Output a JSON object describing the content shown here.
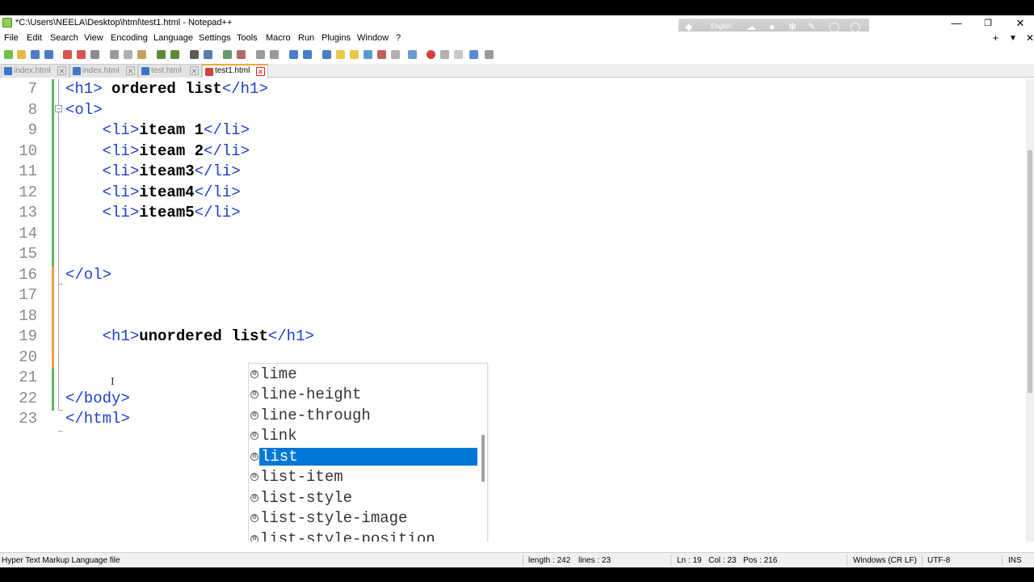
{
  "window": {
    "title": "*C:\\Users\\NEELA\\Desktop\\html\\test1.html - Notepad++",
    "min_glyph": "—",
    "max_glyph": "❐",
    "close_glyph": "✕"
  },
  "langbar": {
    "label": "English"
  },
  "menu": {
    "items": [
      "File",
      "Edit",
      "Search",
      "View",
      "Encoding",
      "Language",
      "Settings",
      "Tools",
      "Macro",
      "Run",
      "Plugins",
      "Window",
      "?"
    ],
    "right": [
      "+",
      "▼",
      "✕"
    ]
  },
  "tabs": [
    {
      "label": "index.html",
      "active": false
    },
    {
      "label": "index.html",
      "active": false
    },
    {
      "label": "test.html",
      "active": false
    },
    {
      "label": "test1.html",
      "active": true
    }
  ],
  "editor": {
    "lines": [
      {
        "n": "7",
        "code": [
          [
            "tag",
            "<h1>"
          ],
          [
            "txt",
            " ordered list"
          ],
          [
            "tag",
            "</h1>"
          ]
        ]
      },
      {
        "n": "8",
        "code": [
          [
            "tag",
            "<ol>"
          ]
        ]
      },
      {
        "n": "9",
        "code": [
          [
            "tag",
            "    <li>"
          ],
          [
            "txt",
            "iteam 1"
          ],
          [
            "tag",
            "</li>"
          ]
        ]
      },
      {
        "n": "10",
        "code": [
          [
            "tag",
            "    <li>"
          ],
          [
            "txt",
            "iteam 2"
          ],
          [
            "tag",
            "</li>"
          ]
        ]
      },
      {
        "n": "11",
        "code": [
          [
            "tag",
            "    <li>"
          ],
          [
            "txt",
            "iteam3"
          ],
          [
            "tag",
            "</li>"
          ]
        ]
      },
      {
        "n": "12",
        "code": [
          [
            "tag",
            "    <li>"
          ],
          [
            "txt",
            "iteam4"
          ],
          [
            "tag",
            "</li>"
          ]
        ]
      },
      {
        "n": "13",
        "code": [
          [
            "tag",
            "    <li>"
          ],
          [
            "txt",
            "iteam5"
          ],
          [
            "tag",
            "</li>"
          ]
        ]
      },
      {
        "n": "14",
        "code": []
      },
      {
        "n": "15",
        "code": []
      },
      {
        "n": "16",
        "code": [
          [
            "tag",
            "</ol>"
          ]
        ]
      },
      {
        "n": "17",
        "code": []
      },
      {
        "n": "18",
        "code": []
      },
      {
        "n": "19",
        "code": [
          [
            "tag",
            "    <h1>"
          ],
          [
            "txt",
            "unordered list"
          ],
          [
            "tag",
            "</h1>"
          ]
        ]
      },
      {
        "n": "20",
        "code": []
      },
      {
        "n": "21",
        "code": []
      },
      {
        "n": "22",
        "code": [
          [
            "tag",
            "</body>"
          ]
        ]
      },
      {
        "n": "23",
        "code": [
          [
            "tag",
            "</html>"
          ]
        ]
      }
    ]
  },
  "autocomplete": {
    "items": [
      "lime",
      "line-height",
      "line-through",
      "link",
      "list",
      "list-item",
      "list-style",
      "list-style-image",
      "list-style-position"
    ],
    "selected": "list"
  },
  "status": {
    "file_type": "Hyper Text Markup Language file",
    "length": "length : 242",
    "lines": "lines : 23",
    "ln": "Ln : 19",
    "col": "Col : 23",
    "pos": "Pos : 216",
    "eol": "Windows (CR LF)",
    "encoding": "UTF-8",
    "mode": "INS"
  },
  "colors": {
    "tag": "#1c3fc8",
    "selection": "#0078d7",
    "changed_saved": "#5cb85c",
    "changed_unsaved": "#f0a040",
    "tab_accent": "#f3a53a"
  }
}
